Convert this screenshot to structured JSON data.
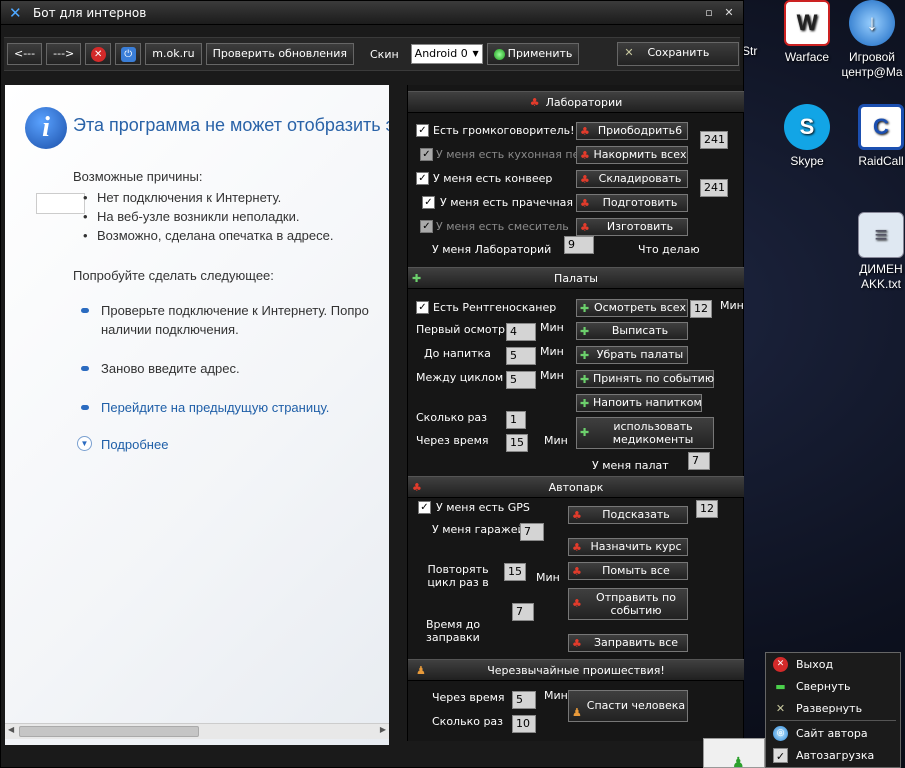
{
  "window": {
    "title": "Бот для интернов",
    "controls": {
      "restore": "▫",
      "close": "✕"
    }
  },
  "toolbar": {
    "back": "<---",
    "forward": "--->",
    "url": "m.ok.ru",
    "check_updates": "Проверить обновления",
    "skin_label": "Скин",
    "skin_value": "Android 0",
    "apply": "Применить",
    "save": "Сохранить"
  },
  "browser_error": {
    "title": "Эта программа не может отобразить э",
    "causes_heading": "Возможные причины:",
    "causes": [
      "Нет подключения к Интернету.",
      "На веб-узле возникли неполадки.",
      "Возможно, сделана опечатка в адресе."
    ],
    "try_heading": "Попробуйте сделать следующее:",
    "suggestions": [
      "Проверьте подключение к Интернету. Попро",
      "наличии подключения.",
      "Заново введите адрес.",
      "Перейдите на предыдущую страницу.",
      "Подробнее"
    ]
  },
  "labs": {
    "header": "Лаборатории",
    "rows": [
      {
        "label": "Есть громкоговоритель!",
        "checked": true,
        "enabled": true,
        "button": "Приободрить6"
      },
      {
        "label": "У меня есть кухонная печь",
        "checked": true,
        "enabled": false,
        "button": "Накормить всех"
      },
      {
        "label": "У меня есть конвеер",
        "checked": true,
        "enabled": true,
        "button": "Складировать"
      },
      {
        "label": "У меня есть прачечная",
        "checked": true,
        "enabled": true,
        "button": "Подготовить"
      },
      {
        "label": "У меня есть смеситель",
        "checked": true,
        "enabled": false,
        "button": "Изготовить"
      }
    ],
    "values": [
      "241",
      "241"
    ],
    "count_label": "У меня Лабораторий",
    "count_value": "9",
    "what_doing": "Что делаю"
  },
  "wards": {
    "header": "Палаты",
    "xray_label": "Есть Рентгеносканер",
    "xray_checked": true,
    "buttons": [
      "Осмотреть всех",
      "Выписать",
      "Убрать палаты",
      "Принять по событию",
      "Напоить напитком",
      "использовать медикоменты"
    ],
    "interval_value": "12",
    "min": "Мин",
    "first_exam_label": "Первый осмотр",
    "first_exam_value": "4",
    "before_drink_label": "До напитка",
    "before_drink_value": "5",
    "between_cycle_label": "Между циклом",
    "between_cycle_value": "5",
    "times_label": "Сколько раз",
    "times_value": "1",
    "after_time_label": "Через время",
    "after_time_value": "15",
    "count_label": "У меня палат",
    "count_value": "7"
  },
  "autopark": {
    "header": "Автопарк",
    "gps_label": "У меня есть GPS",
    "gps_checked": true,
    "garages_label": "У меня гаражей",
    "garages_value": "7",
    "buttons": [
      "Подсказать",
      "Назначить курс",
      "Помыть все",
      "Отправить по событию",
      "Заправить все"
    ],
    "hint_value": "12",
    "repeat_label": "Повторять цикл раз в",
    "repeat_value": "15",
    "min": "Мин",
    "refuel_label": "Время до заправки",
    "refuel_value": "7"
  },
  "emergencies": {
    "header": "Черезвычайные проишествия!",
    "after_time_label": "Через время",
    "after_time_value": "5",
    "min": "Мин",
    "times_label": "Сколько раз",
    "times_value": "10",
    "button": "Спасти человека"
  },
  "desktop": {
    "partial_label": "Str",
    "icons": [
      {
        "name": "warface",
        "label": "Warface",
        "glyph": "W"
      },
      {
        "name": "games",
        "label1": "Игровой",
        "label2": "центр@Ma",
        "glyph": "↓"
      },
      {
        "name": "skype",
        "label": "Skype",
        "glyph": "S"
      },
      {
        "name": "raidcall",
        "label": "RaidCall",
        "glyph": "C"
      },
      {
        "name": "txt",
        "label1": "ДИМЕН",
        "label2": "AKK.txt",
        "glyph": "≡"
      }
    ]
  },
  "tray_menu": {
    "items": [
      {
        "label": "Выход",
        "icon": "close-red-icon"
      },
      {
        "label": "Свернуть",
        "icon": "minimize-green-icon"
      },
      {
        "label": "Развернуть",
        "icon": "crossed-swords-icon"
      },
      {
        "label": "Сайт автора",
        "icon": "globe-icon"
      },
      {
        "label": "Автозагрузка",
        "icon": "checkbox-icon",
        "checked": true
      }
    ]
  }
}
